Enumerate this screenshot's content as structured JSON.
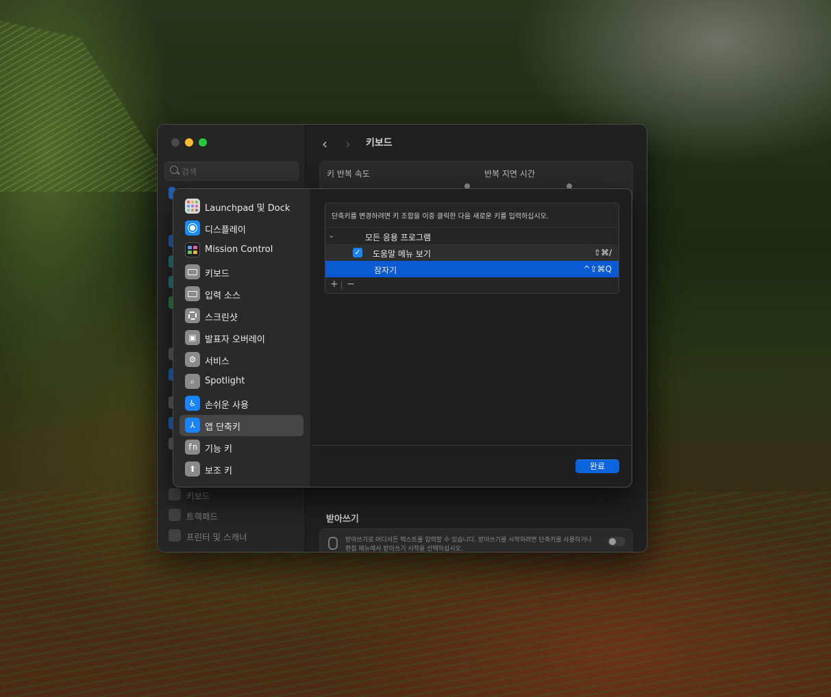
{
  "window": {
    "search_placeholder": "검색",
    "title": "키보드",
    "sidebar_bottom": [
      {
        "label": "키보드",
        "icon": "keyboard-icon"
      },
      {
        "label": "트랙패드",
        "icon": "trackpad-icon"
      },
      {
        "label": "프린터 및 스캐너",
        "icon": "printer-icon"
      }
    ],
    "key_repeat_label": "키 반복 속도",
    "delay_label": "반복 지연 시간",
    "dictation_title": "받아쓰기",
    "dictation_desc": "받아쓰기로 어디서든 텍스트를 입력할 수 있습니다. 받아쓰기를 시작하려면 단축키를 사용하거나 편집 메뉴에서 받아쓰기 시작을 선택하십시오."
  },
  "sheet": {
    "categories": [
      {
        "label": "Launchpad 및 Dock",
        "icon": "launchpad-icon"
      },
      {
        "label": "디스플레이",
        "icon": "display-icon"
      },
      {
        "label": "Mission Control",
        "icon": "mission-control-icon"
      },
      {
        "label": "키보드",
        "icon": "keyboard-icon"
      },
      {
        "label": "입력 소스",
        "icon": "input-source-icon"
      },
      {
        "label": "스크린샷",
        "icon": "screenshot-icon"
      },
      {
        "label": "발표자 오버레이",
        "icon": "presenter-overlay-icon"
      },
      {
        "label": "서비스",
        "icon": "services-icon"
      },
      {
        "label": "Spotlight",
        "icon": "spotlight-icon"
      },
      {
        "label": "손쉬운 사용",
        "icon": "accessibility-icon"
      },
      {
        "label": "앱 단축키",
        "icon": "app-shortcuts-icon",
        "selected": true
      },
      {
        "label": "기능 키",
        "icon": "function-keys-icon"
      },
      {
        "label": "보조 키",
        "icon": "modifier-keys-icon"
      }
    ],
    "hint": "단축키를 변경하려면 키 조합을 이중 클릭한 다음 새로운 키를 입력하십시오.",
    "group_label": "모든 응용 프로그램",
    "shortcuts": [
      {
        "name": "도움말 메뉴 보기",
        "keys": "⇧⌘/",
        "checked": true,
        "selected": false
      },
      {
        "name": "잠자기",
        "keys": "^⇧⌘Q",
        "checked": false,
        "selected": true
      }
    ],
    "add_label": "+",
    "remove_label": "−",
    "done_label": "완료"
  },
  "colors": {
    "accent": "#0a64de",
    "selection": "#0a5bd3",
    "window_bg": "#202020",
    "sidebar_bg": "#262626"
  }
}
